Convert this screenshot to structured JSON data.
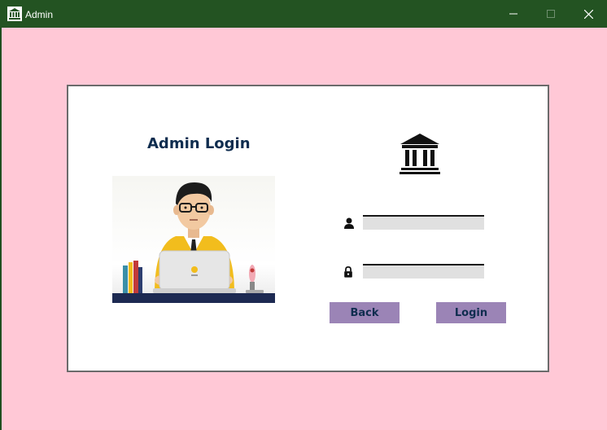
{
  "window": {
    "title": "Admin",
    "app_icon": "bank-icon",
    "controls": {
      "minimize_icon": "minimize-icon",
      "maximize_icon": "maximize-icon",
      "close_icon": "close-icon"
    },
    "titlebar_color": "#235322",
    "background_color": "#ffc8d6"
  },
  "login": {
    "heading": "Admin Login",
    "illustration": "admin-with-laptop-illustration",
    "logo_icon": "bank-icon",
    "username": {
      "icon": "user-icon",
      "value": "",
      "placeholder": ""
    },
    "password": {
      "icon": "lock-icon",
      "value": "",
      "placeholder": ""
    },
    "back_label": "Back",
    "login_label": "Login",
    "button_color": "#9b84b6",
    "text_color": "#0f2d4f"
  }
}
